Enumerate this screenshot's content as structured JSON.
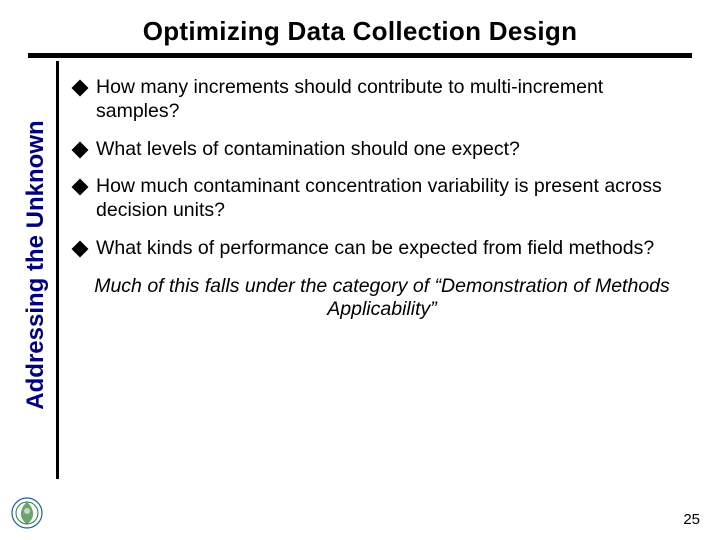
{
  "title": "Optimizing Data Collection Design",
  "sidebar_label": "Addressing the Unknown",
  "bullets": [
    "How many increments should contribute to multi-increment samples?",
    "What levels of contamination should one expect?",
    "How much contaminant concentration variability is present across decision units?",
    "What kinds of performance can be expected from field methods?"
  ],
  "conclusion": "Much of this falls under the category of “Demonstration of Methods Applicability”",
  "page_number": "25"
}
